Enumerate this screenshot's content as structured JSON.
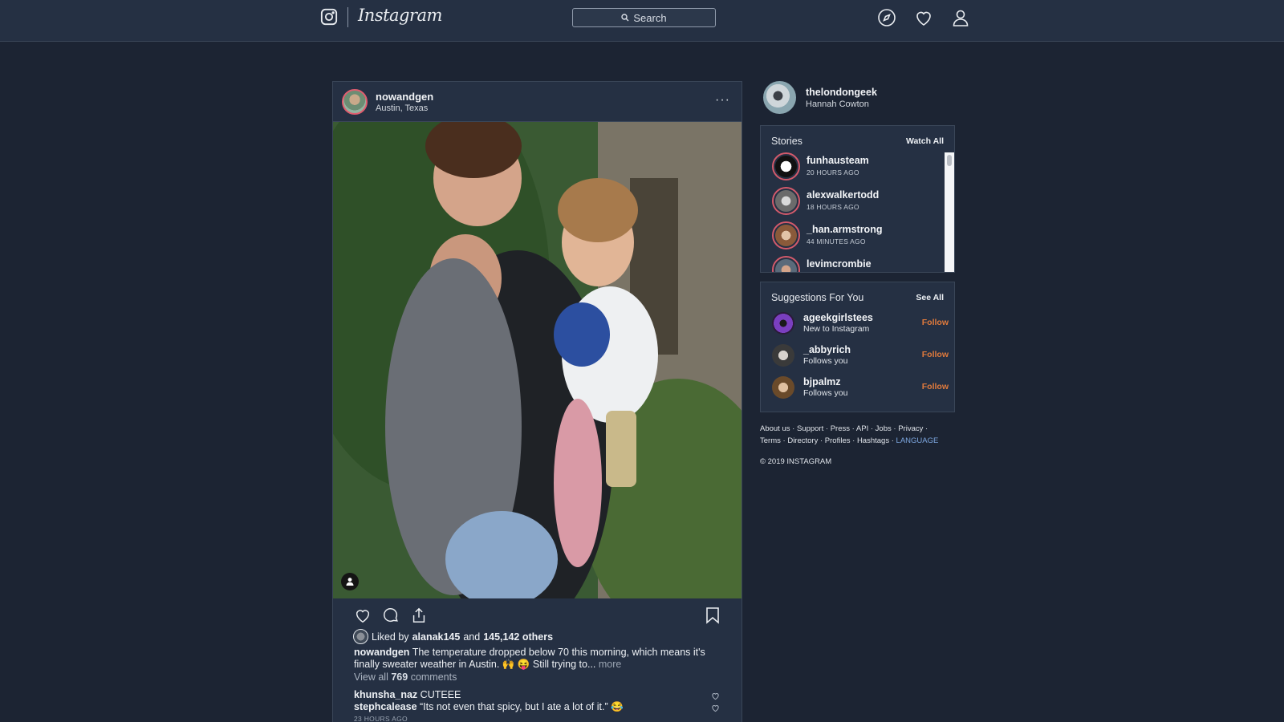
{
  "nav": {
    "wordmark": "Instagram",
    "search_placeholder": "Search",
    "icons": [
      "instagram-camera-icon",
      "search-icon",
      "compass-icon",
      "heart-icon",
      "profile-icon"
    ]
  },
  "post": {
    "username": "nowandgen",
    "location": "Austin, Texas",
    "more_label": "···",
    "likes": {
      "prefix": "Liked by",
      "user": "alanak145",
      "joiner": "and",
      "others": "145,142 others"
    },
    "caption": {
      "user": "nowandgen",
      "text": "The temperature dropped below 70 this morning, which means it's finally sweater weather in Austin. 🙌 😝 Still trying to...",
      "more": "more"
    },
    "view_comments": {
      "prefix": "View all",
      "count": "769",
      "suffix": "comments"
    },
    "comments": [
      {
        "user": "khunsha_naz",
        "text": "CUTEEE"
      },
      {
        "user": "stephcalease",
        "text": "“Its not even that spicy, but I ate a lot of it.” 😂"
      }
    ],
    "time": "23 HOURS AGO"
  },
  "sidebar": {
    "me": {
      "username": "thelondongeek",
      "name": "Hannah Cowton"
    },
    "stories": {
      "title": "Stories",
      "link": "Watch All",
      "items": [
        {
          "name": "funhausteam",
          "time": "20 HOURS AGO"
        },
        {
          "name": "alexwalkertodd",
          "time": "18 HOURS AGO"
        },
        {
          "name": "_han.armstrong",
          "time": "44 MINUTES AGO"
        },
        {
          "name": "levimcrombie",
          "time": ""
        }
      ]
    },
    "suggestions": {
      "title": "Suggestions For You",
      "link": "See All",
      "items": [
        {
          "name": "ageekgirlstees",
          "sub": "New to Instagram",
          "action": "Follow"
        },
        {
          "name": "_abbyrich",
          "sub": "Follows you",
          "action": "Follow"
        },
        {
          "name": "bjpalmz",
          "sub": "Follows you",
          "action": "Follow"
        }
      ]
    },
    "footer": {
      "links1": [
        "About us",
        "Support",
        "Press",
        "API",
        "Jobs",
        "Privacy"
      ],
      "links2": [
        "Terms",
        "Directory",
        "Profiles",
        "Hashtags"
      ],
      "language": "LANGUAGE",
      "separator": " · ",
      "copyright": "© 2019 INSTAGRAM"
    }
  },
  "colors": {
    "background": "#1c2433",
    "panel": "#253043",
    "follow": "#e07a3c",
    "story_ring": "#d35a6b",
    "language_link": "#7da7e0"
  }
}
